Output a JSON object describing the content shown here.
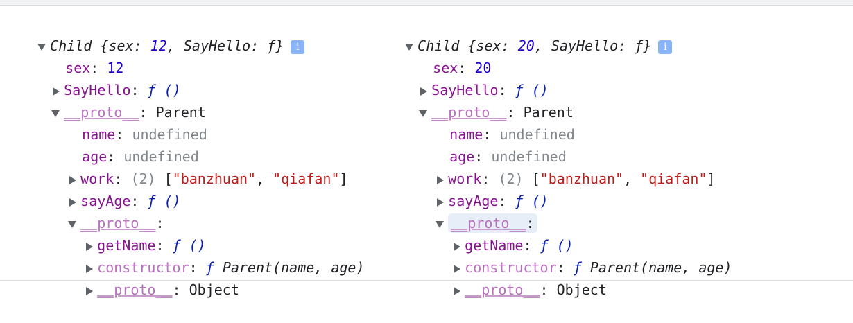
{
  "left": {
    "header_prefix": "Child {",
    "header_sex_key": "sex: ",
    "header_sex_val": "12",
    "header_mid": ", SayHello: ",
    "header_fn": "ƒ",
    "header_suffix": "}",
    "sex_key": "sex",
    "sex_val": "12",
    "sayhello_key": "SayHello",
    "sayhello_val": "ƒ ()",
    "proto_key": "__proto__",
    "proto_val": "Parent",
    "name_key": "name",
    "name_val": "undefined",
    "age_key": "age",
    "age_val": "undefined",
    "work_key": "work",
    "work_count": "(2)",
    "work_item1": "\"banzhuan\"",
    "work_item2": "\"qiafan\"",
    "sayage_key": "sayAge",
    "sayage_val": "ƒ ()",
    "proto2_key": "__proto__",
    "getname_key": "getName",
    "getname_val": "ƒ ()",
    "constructor_key": "constructor",
    "constructor_fn": "ƒ",
    "constructor_val": "Parent(name, age)",
    "proto3_key": "__proto__",
    "proto3_val": "Object"
  },
  "right": {
    "header_prefix": "Child {",
    "header_sex_key": "sex: ",
    "header_sex_val": "20",
    "header_mid": ", SayHello: ",
    "header_fn": "ƒ",
    "header_suffix": "}",
    "sex_key": "sex",
    "sex_val": "20",
    "sayhello_key": "SayHello",
    "sayhello_val": "ƒ ()",
    "proto_key": "__proto__",
    "proto_val": "Parent",
    "name_key": "name",
    "name_val": "undefined",
    "age_key": "age",
    "age_val": "undefined",
    "work_key": "work",
    "work_count": "(2)",
    "work_item1": "\"banzhuan\"",
    "work_item2": "\"qiafan\"",
    "sayage_key": "sayAge",
    "sayage_val": "ƒ ()",
    "proto2_key": "__proto__",
    "getname_key": "getName",
    "getname_val": "ƒ ()",
    "constructor_key": "constructor",
    "constructor_fn": "ƒ",
    "constructor_val": "Parent(name, age)",
    "proto3_key": "__proto__",
    "proto3_val": "Object"
  },
  "info_icon": "i",
  "colors": {
    "key": "#881391",
    "proto_key": "#b871bd",
    "number": "#1c00cf",
    "string": "#c41a16",
    "undefined": "#80868b",
    "function": "#0d22aa",
    "info_badge": "#8ab4f8"
  }
}
